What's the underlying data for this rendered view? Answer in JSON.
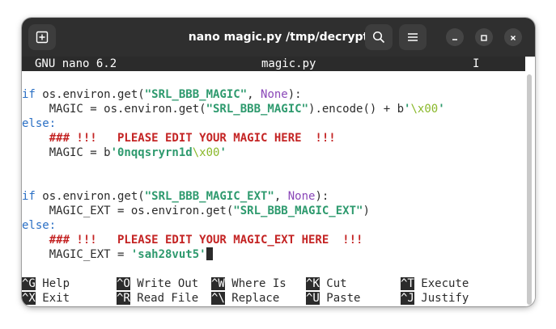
{
  "window": {
    "title": "nano magic.py /tmp/decrypt",
    "icons": {
      "new_tab": "new-tab-icon",
      "search": "search-icon",
      "menu": "hamburger-menu-icon",
      "minimize": "minimize-icon",
      "maximize": "maximize-icon",
      "close": "close-icon"
    }
  },
  "nano": {
    "version": "GNU nano 6.2",
    "filename": "magic.py",
    "status_mark": "I"
  },
  "code": {
    "l1": {
      "kw": "if",
      "a": " os.environ.get(",
      "str": "\"SRL_BBB_MAGIC\"",
      "b": ", ",
      "bi": "None",
      "c": "):"
    },
    "l2": {
      "a": "    MAGIC = os.environ.get(",
      "str": "\"SRL_BBB_MAGIC\"",
      "b": ").encode() + b",
      "q1": "'",
      "esc": "\\x00",
      "q2": "'"
    },
    "l3": {
      "kw": "else:"
    },
    "l4": {
      "cmt": "    ### !!!   PLEASE EDIT YOUR MAGIC HERE  !!!"
    },
    "l5": {
      "a": "    MAGIC = b",
      "str1": "'0nqqsryrn1d",
      "esc": "\\x00",
      "str2": "'"
    },
    "l6": {
      "kw": "if",
      "a": " os.environ.get(",
      "str": "\"SRL_BBB_MAGIC_EXT\"",
      "b": ", ",
      "bi": "None",
      "c": "):"
    },
    "l7": {
      "a": "    MAGIC_EXT = os.environ.get(",
      "str": "\"SRL_BBB_MAGIC_EXT\"",
      "b": ")"
    },
    "l8": {
      "kw": "else:"
    },
    "l9": {
      "cmt": "    ### !!!   PLEASE EDIT YOUR MAGIC_EXT HERE  !!!"
    },
    "l10": {
      "a": "    MAGIC_EXT = ",
      "str": "'sah28vut5'"
    }
  },
  "shortcuts": {
    "row1": [
      {
        "key": "^G",
        "label": " Help"
      },
      {
        "key": "^O",
        "label": " Write Out"
      },
      {
        "key": "^W",
        "label": " Where Is"
      },
      {
        "key": "^K",
        "label": " Cut"
      },
      {
        "key": "^T",
        "label": " Execute"
      }
    ],
    "row2": [
      {
        "key": "^X",
        "label": " Exit"
      },
      {
        "key": "^R",
        "label": " Read File"
      },
      {
        "key": "^\\",
        "label": " Replace"
      },
      {
        "key": "^U",
        "label": " Paste"
      },
      {
        "key": "^J",
        "label": " Justify"
      }
    ]
  }
}
